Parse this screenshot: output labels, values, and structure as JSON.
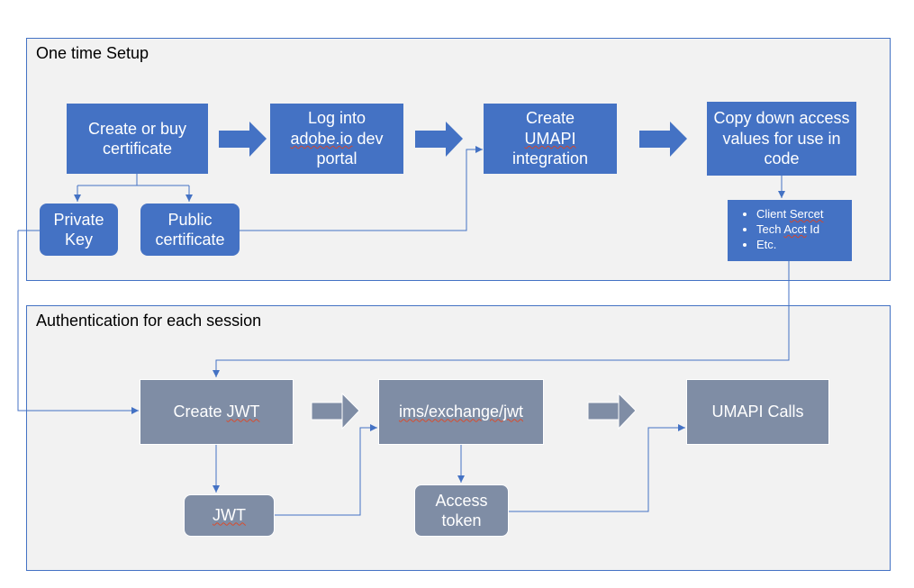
{
  "sections": {
    "setup": {
      "title": "One time Setup"
    },
    "auth": {
      "title": "Authentication for each session"
    }
  },
  "setup_boxes": {
    "cert": "Create or buy certificate",
    "login_l1": "Log into",
    "login_l2": "adobe.io",
    "login_l3": " dev portal",
    "create_l1": "Create ",
    "create_l2": "UMAPI",
    "create_l3": " integration",
    "copy": "Copy down access values for  use in code",
    "priv_key": "Private Key",
    "pub_cert": "Public certificate"
  },
  "bullets": {
    "b1a": "Client ",
    "b1b": "Sercet",
    "b2a": "Tech ",
    "b2b": "Acct",
    "b2c": " Id",
    "b3": "Etc."
  },
  "auth_boxes": {
    "create_jwt_a": "Create ",
    "create_jwt_b": "JWT",
    "ims_a": "ims/exchange/",
    "ims_b": "jwt",
    "umapi": "UMAPI Calls",
    "jwt_a": "JWT",
    "token": "Access token"
  },
  "chart_data": {
    "type": "flow",
    "sections": [
      {
        "id": "setup",
        "title": "One time Setup",
        "nodes": [
          {
            "id": "cert",
            "label": "Create or buy certificate"
          },
          {
            "id": "login",
            "label": "Log into adobe.io dev portal"
          },
          {
            "id": "umapi",
            "label": "Create UMAPI integration"
          },
          {
            "id": "copy",
            "label": "Copy down access values for use in code"
          },
          {
            "id": "privkey",
            "label": "Private Key"
          },
          {
            "id": "pubcert",
            "label": "Public certificate"
          },
          {
            "id": "vals",
            "label": "Client Secret / Tech Acct Id / Etc."
          }
        ],
        "edges": [
          [
            "cert",
            "login",
            "big-arrow"
          ],
          [
            "login",
            "umapi",
            "big-arrow"
          ],
          [
            "umapi",
            "copy",
            "big-arrow"
          ],
          [
            "cert",
            "privkey",
            "line"
          ],
          [
            "cert",
            "pubcert",
            "line"
          ],
          [
            "pubcert",
            "umapi",
            "line"
          ],
          [
            "copy",
            "vals",
            "line"
          ]
        ]
      },
      {
        "id": "auth",
        "title": "Authentication for each session",
        "nodes": [
          {
            "id": "createjwt",
            "label": "Create JWT"
          },
          {
            "id": "ims",
            "label": "ims/exchange/jwt"
          },
          {
            "id": "calls",
            "label": "UMAPI Calls"
          },
          {
            "id": "jwt",
            "label": "JWT"
          },
          {
            "id": "token",
            "label": "Access token"
          }
        ],
        "edges": [
          [
            "createjwt",
            "ims",
            "big-arrow"
          ],
          [
            "ims",
            "calls",
            "big-arrow"
          ],
          [
            "createjwt",
            "jwt",
            "line"
          ],
          [
            "jwt",
            "ims",
            "line"
          ],
          [
            "ims",
            "token",
            "line"
          ],
          [
            "token",
            "calls",
            "line"
          ]
        ],
        "cross_edges": [
          [
            "setup.vals",
            "auth.createjwt",
            "line"
          ],
          [
            "setup.privkey",
            "auth.createjwt",
            "line"
          ]
        ]
      }
    ]
  }
}
